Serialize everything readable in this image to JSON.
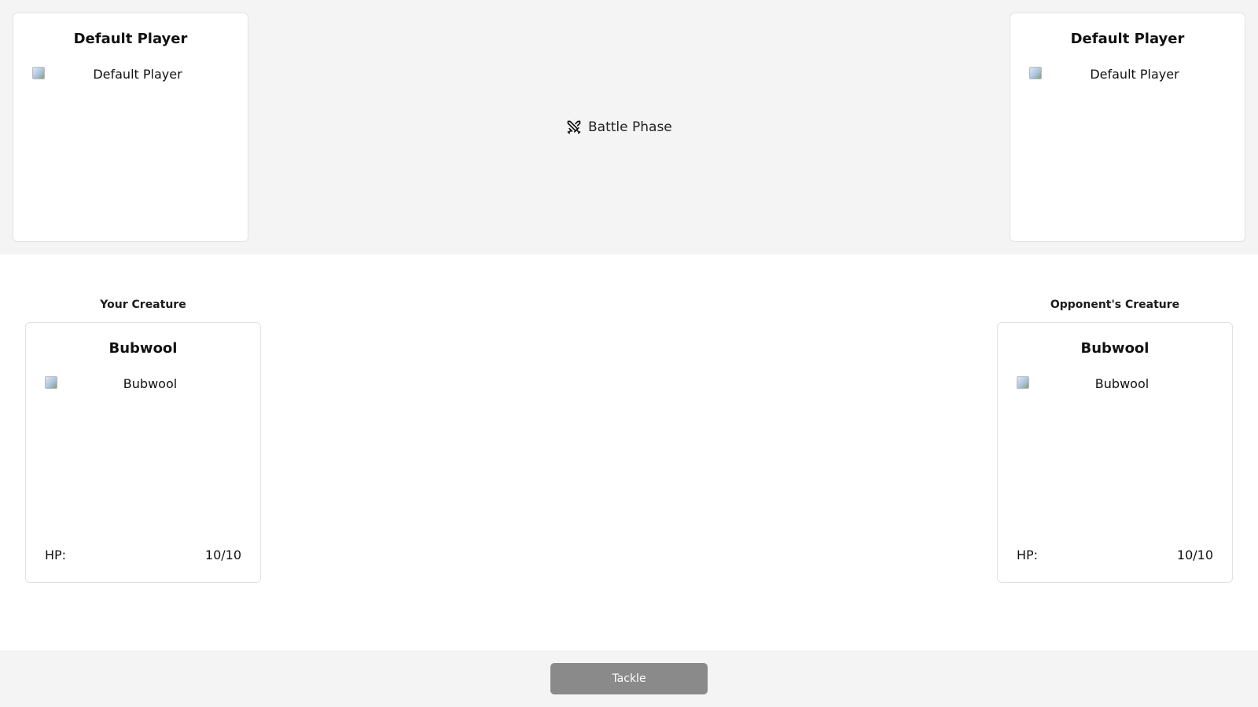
{
  "top": {
    "left_player": {
      "name": "Default Player",
      "image_alt": "Default Player"
    },
    "right_player": {
      "name": "Default Player",
      "image_alt": "Default Player"
    },
    "phase": {
      "icon": "crossed-swords-icon",
      "label": "Battle Phase"
    }
  },
  "battle": {
    "your_label": "Your Creature",
    "opponent_label": "Opponent's Creature",
    "your_creature": {
      "name": "Bubwool",
      "image_alt": "Bubwool",
      "hp_label": "HP:",
      "hp_value": "10/10"
    },
    "opponent_creature": {
      "name": "Bubwool",
      "image_alt": "Bubwool",
      "hp_label": "HP:",
      "hp_value": "10/10"
    }
  },
  "actions": {
    "tackle_label": "Tackle"
  },
  "colors": {
    "bar_bg": "#f4f4f4",
    "button_bg": "#8a8a8a",
    "card_border": "#e2e2e2"
  }
}
